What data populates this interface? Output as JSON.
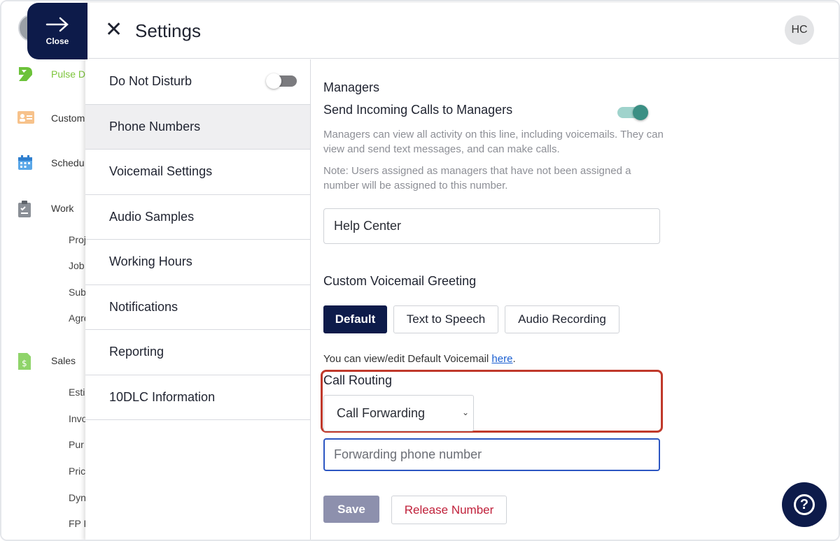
{
  "bg_app": {
    "nav": [
      {
        "label": "Pulse D",
        "icon": "pulse-logo-icon",
        "color": "#7cc53a"
      },
      {
        "label": "Custom",
        "icon": "contact-card-icon"
      },
      {
        "label": "Schedu",
        "icon": "calendar-icon"
      },
      {
        "label": "Work",
        "icon": "clipboard-icon"
      },
      {
        "label": "Sales",
        "icon": "invoice-dollar-icon"
      }
    ],
    "work_sub": [
      "Proj",
      "Job",
      "Sub",
      "Agre"
    ],
    "sales_sub": [
      "Esti",
      "Invo",
      "Pur",
      "Pric",
      "Dyn",
      "FP F"
    ]
  },
  "close_tab": {
    "label": "Close",
    "icon": "arrow-right-icon"
  },
  "header": {
    "title": "Settings",
    "user_initials": "HC",
    "close_icon": "close-icon"
  },
  "leftnav": {
    "items": [
      {
        "label": "Do Not Disturb",
        "toggle": false
      },
      {
        "label": "Phone Numbers",
        "active": true
      },
      {
        "label": "Voicemail Settings"
      },
      {
        "label": "Audio Samples"
      },
      {
        "label": "Working Hours"
      },
      {
        "label": "Notifications"
      },
      {
        "label": "Reporting"
      },
      {
        "label": "10DLC Information"
      }
    ]
  },
  "main": {
    "managers_title": "Managers",
    "send_calls_label": "Send Incoming Calls to Managers",
    "send_calls_enabled": true,
    "managers_help": "Managers can view all activity on this line, including voicemails. They can view and send text messages, and can make calls.",
    "managers_note": "Note: Users assigned as managers that have not been assigned a number will be assigned to this number.",
    "manager_value": "Help Center",
    "voicemail_title": "Custom Voicemail Greeting",
    "greeting_options": [
      "Default",
      "Text to Speech",
      "Audio Recording"
    ],
    "greeting_selected": "Default",
    "voicemail_note_prefix": "You can view/edit Default Voicemail ",
    "voicemail_note_link": "here",
    "voicemail_note_suffix": ".",
    "call_routing_title": "Call Routing",
    "call_routing_value": "Call Forwarding",
    "forwarding_placeholder": "Forwarding phone number",
    "save_label": "Save",
    "release_label": "Release Number"
  },
  "help_button": {
    "icon": "question-icon"
  },
  "colors": {
    "navy": "#0d1b4a",
    "teal": "#3b8f84",
    "danger": "#c0203a",
    "highlight": "#c0392b"
  }
}
